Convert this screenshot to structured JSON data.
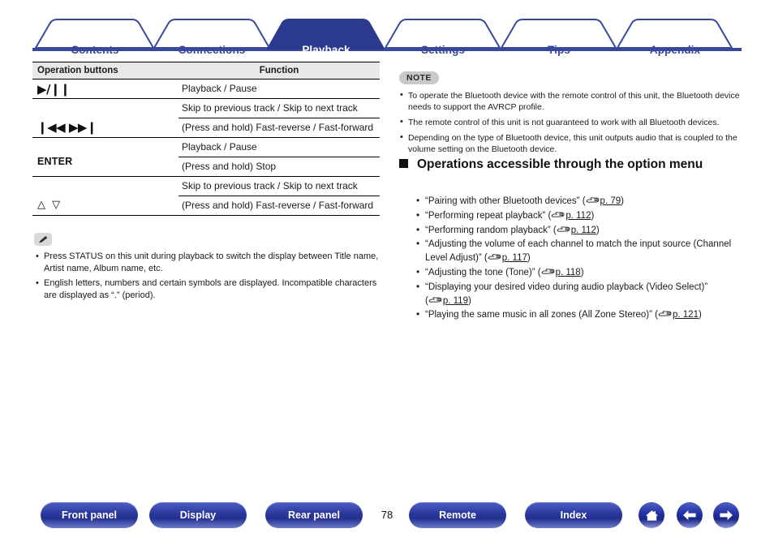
{
  "nav_tabs": [
    {
      "label": "Contents",
      "active": false
    },
    {
      "label": "Connections",
      "active": false
    },
    {
      "label": "Playback",
      "active": true
    },
    {
      "label": "Settings",
      "active": false
    },
    {
      "label": "Tips",
      "active": false
    },
    {
      "label": "Appendix",
      "active": false
    }
  ],
  "table": {
    "headers": {
      "buttons": "Operation buttons",
      "function": "Function"
    },
    "rows": [
      {
        "button_glyph": "▶/❙❙",
        "button_type": "glyph",
        "functions": [
          "Playback / Pause"
        ]
      },
      {
        "button_glyph": "❙◀◀ ▶▶❙",
        "button_type": "glyph",
        "functions": [
          "Skip to previous track / Skip to next track",
          "(Press and hold) Fast-reverse / Fast-forward"
        ]
      },
      {
        "button_glyph": "ENTER",
        "button_type": "text",
        "functions": [
          "Playback / Pause",
          "(Press and hold) Stop"
        ]
      },
      {
        "button_glyph": "△ ▽",
        "button_type": "arrows",
        "functions": [
          "Skip to previous track / Skip to next track",
          "(Press and hold) Fast-reverse / Fast-forward"
        ]
      }
    ]
  },
  "memo": {
    "badge_icon": "pencil-icon",
    "items": [
      "Press STATUS on this unit during playback to switch the display between Title name, Artist name, Album name, etc.",
      "English letters, numbers and certain symbols are displayed. Incompatible characters are displayed as “.” (period)."
    ]
  },
  "note": {
    "badge": "NOTE",
    "items": [
      "To operate the Bluetooth device with the remote control of this unit, the Bluetooth device needs to support the AVRCP profile.",
      "The remote control of this unit is not guaranteed to work with all Bluetooth devices.",
      "Depending on the type of Bluetooth device, this unit outputs audio that is coupled to the volume setting on the Bluetooth device."
    ]
  },
  "section": {
    "heading": "Operations accessible through the option menu",
    "links": [
      {
        "text": "“Pairing with other Bluetooth devices”",
        "page": "p. 79"
      },
      {
        "text": "“Performing repeat playback”",
        "page": "p. 112"
      },
      {
        "text": "“Performing random playback”",
        "page": "p. 112"
      },
      {
        "text": "“Adjusting the volume of each channel to match the input source (Channel Level Adjust)”",
        "page": "p. 117"
      },
      {
        "text": "“Adjusting the tone (Tone)”",
        "page": "p. 118"
      },
      {
        "text": "“Displaying your desired video during audio playback (Video Select)”",
        "page": "p. 119"
      },
      {
        "text": "“Playing the same music in all zones (All Zone Stereo)”",
        "page": "p. 121"
      }
    ]
  },
  "footer": {
    "buttons": [
      {
        "label": "Front panel"
      },
      {
        "label": "Display"
      },
      {
        "label": "Rear panel"
      },
      {
        "label": "Remote"
      },
      {
        "label": "Index"
      }
    ],
    "page_number": "78",
    "icons": [
      "home-icon",
      "arrow-left-icon",
      "arrow-right-icon"
    ]
  },
  "colors": {
    "brand_blue": "#38489b",
    "tab_active_fill": "#2b3a8f",
    "table_header_bg": "#e8e8e8",
    "note_badge_bg": "#c9c9c9"
  }
}
